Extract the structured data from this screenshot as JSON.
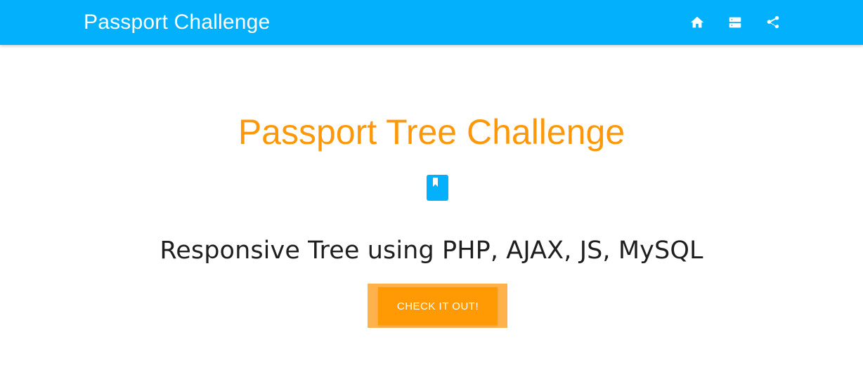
{
  "navbar": {
    "brand": "Passport Challenge",
    "background_color": "#03b0fb",
    "icons": [
      "home-icon",
      "server-icon",
      "share-icon"
    ]
  },
  "hero": {
    "title": "Passport Tree Challenge",
    "title_color": "#ff9809",
    "icon": "book-icon",
    "icon_color": "#03b0fb",
    "subtitle": "Responsive Tree using PHP, AJAX, JS, MySQL",
    "cta_label": "CHECK IT OUT!",
    "cta_color": "#ff9a05"
  }
}
